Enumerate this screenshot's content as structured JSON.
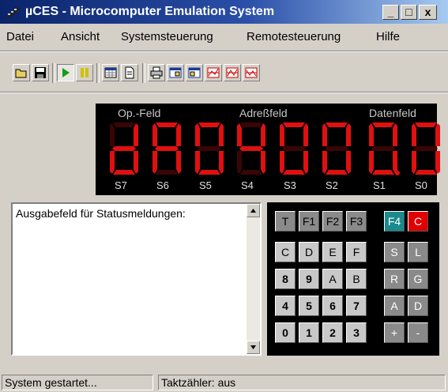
{
  "window": {
    "title": "µCES - Microcomputer Emulation System",
    "controls": {
      "minimize": "_",
      "maximize": "□",
      "close": "x"
    }
  },
  "menu": [
    "Datei",
    "Ansicht",
    "Systemsteuerung",
    "Remotesteuerung",
    "Hilfe"
  ],
  "toolbar": [
    "open-icon",
    "save-icon",
    "play-icon",
    "pause-icon",
    "register-icon",
    "document-icon",
    "printer-icon",
    "config-icon",
    "config-icon",
    "graph-icon",
    "graph-icon",
    "graph-icon"
  ],
  "display": {
    "sections": [
      "Op.-Feld",
      "Adreßfeld",
      "Datenfeld"
    ],
    "digits": [
      "d",
      "A",
      "0",
      "4",
      "0",
      "0",
      "0",
      "0"
    ],
    "dot_after_index": 6,
    "slots": [
      "S7",
      "S6",
      "S5",
      "S4",
      "S3",
      "S2",
      "S1",
      "S0"
    ],
    "colors": {
      "on": "#e01010",
      "off": "#3a0505"
    }
  },
  "output": {
    "label": "Ausgabefeld für Statusmeldungen:"
  },
  "keypad": {
    "rows": [
      [
        "T",
        "F1",
        "F2",
        "F3",
        "F4",
        "C"
      ],
      [
        "C",
        "D",
        "E",
        "F",
        "S",
        "L"
      ],
      [
        "8",
        "9",
        "A",
        "B",
        "R",
        "G"
      ],
      [
        "4",
        "5",
        "6",
        "7",
        "A",
        "D"
      ],
      [
        "0",
        "1",
        "2",
        "3",
        "+",
        "-"
      ]
    ],
    "colors": {
      "light": "#c8c8c8",
      "dark": "#8a8a8a",
      "f4": "#1a8a8c",
      "c_red": "#e00000"
    }
  },
  "status": {
    "left": "System gestartet...",
    "right": "Taktzähler: aus"
  }
}
